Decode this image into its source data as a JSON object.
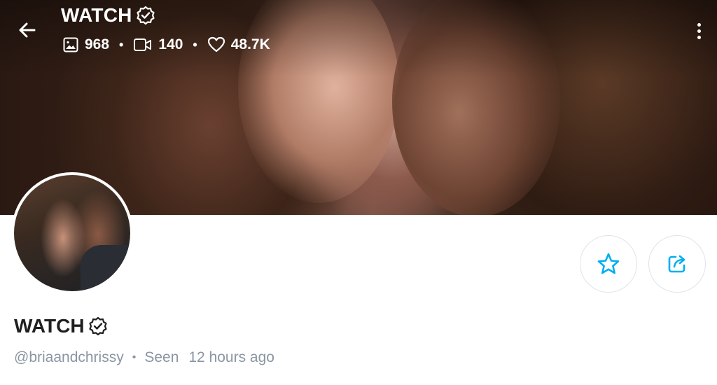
{
  "header": {
    "title": "WATCH",
    "stats": {
      "photos": "968",
      "videos": "140",
      "likes": "48.7K"
    }
  },
  "profile": {
    "name": "WATCH",
    "username": "@briaandchrissy",
    "seen_label": "Seen",
    "seen_time": "12 hours ago"
  },
  "colors": {
    "accent": "#00aff0",
    "muted": "#8a96a3",
    "text": "#1f1f1f"
  },
  "icons": {
    "back": "arrow-left-icon",
    "verified": "verified-badge-icon",
    "photos": "image-icon",
    "videos": "video-icon",
    "likes": "heart-icon",
    "more": "more-vertical-icon",
    "favorite": "star-icon",
    "share": "share-icon"
  }
}
